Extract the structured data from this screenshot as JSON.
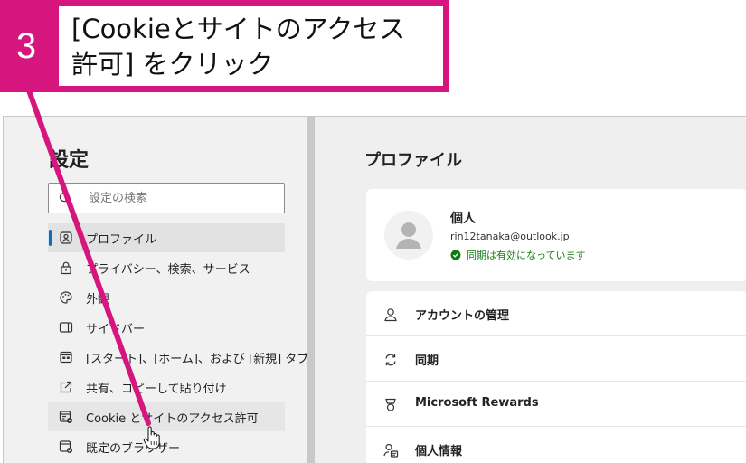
{
  "callout": {
    "step_number": "3",
    "line1": "[Cookieとサイトのアクセス",
    "line2": "許可] をクリック",
    "accent_color": "#d6157e"
  },
  "sidebar": {
    "title": "設定",
    "search_placeholder": "設定の検索",
    "items": [
      {
        "label": "プロファイル",
        "icon": "profile-icon",
        "state": "active"
      },
      {
        "label": "プライバシー、検索、サービス",
        "icon": "lock-icon"
      },
      {
        "label": "外観",
        "icon": "palette-icon"
      },
      {
        "label": "サイドバー",
        "icon": "sidebar-icon"
      },
      {
        "label": "[スタート]、[ホーム]、および [新規] タブ",
        "icon": "home-tabs-icon"
      },
      {
        "label": "共有、コピーして貼り付け",
        "icon": "share-icon"
      },
      {
        "label": "Cookie とサイトのアクセス許可",
        "icon": "site-permissions-icon",
        "state": "hover"
      },
      {
        "label": "既定のブラウザー",
        "icon": "default-browser-icon"
      }
    ]
  },
  "main": {
    "title": "プロファイル",
    "profile": {
      "name": "個人",
      "email": "rin12tanaka@outlook.jp",
      "sync_status": "同期は有効になっています"
    },
    "rows": [
      {
        "label": "アカウントの管理",
        "icon": "account-icon"
      },
      {
        "label": "同期",
        "icon": "sync-icon"
      },
      {
        "label": "Microsoft Rewards",
        "icon": "rewards-icon"
      },
      {
        "label": "個人情報",
        "icon": "personal-info-icon"
      }
    ]
  },
  "colors": {
    "accent": "#0f6cbd",
    "sync_ok": "#107c10",
    "callout": "#d6157e"
  }
}
